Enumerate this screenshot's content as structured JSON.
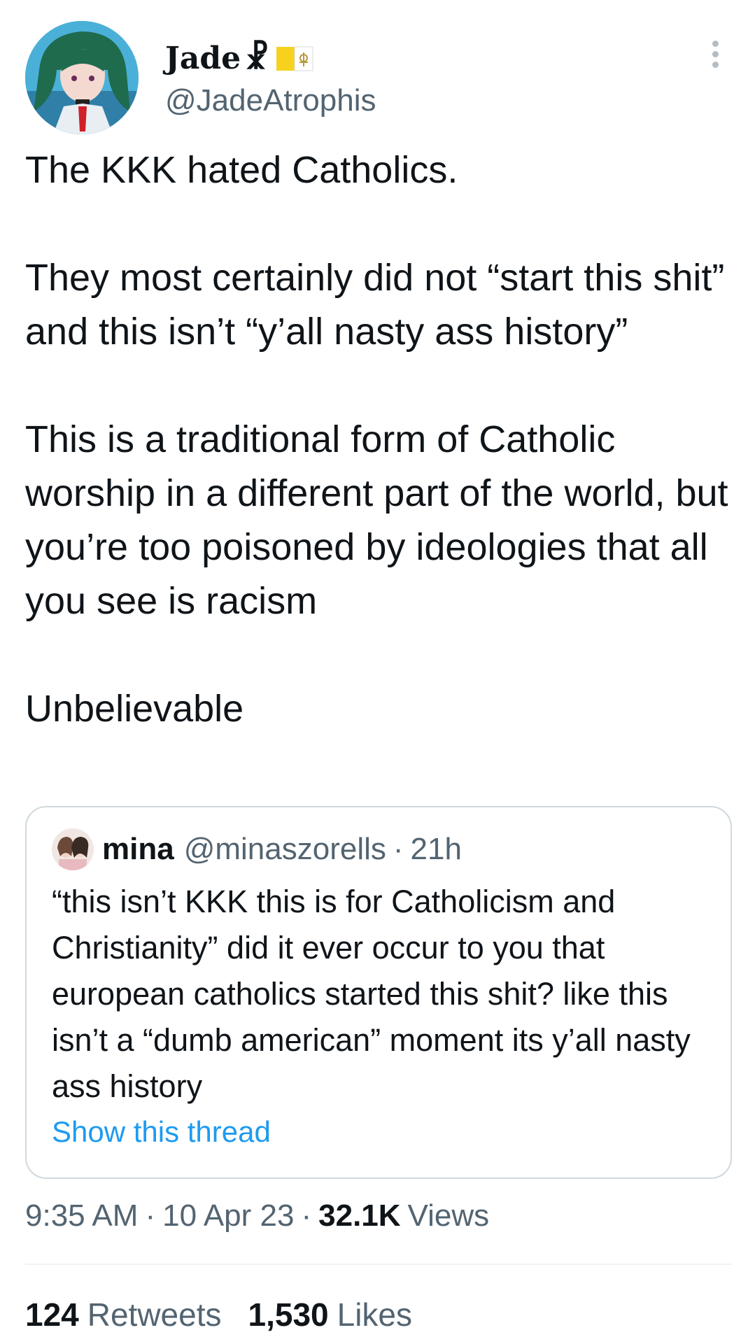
{
  "tweet": {
    "display_name": "Jade",
    "display_symbol": "☧",
    "handle": "@JadeAtrophis",
    "paragraphs": [
      "The KKK hated Catholics.",
      "They most certainly did not “start this shit” and this isn’t “y’all nasty ass history”",
      "This is a traditional form of Catholic worship in a different part of the world, but you’re too poisoned by ideologies that all you see is racism",
      "Unbelievable"
    ]
  },
  "quote": {
    "name": "mina",
    "handle": "@minaszorells",
    "separator": "·",
    "time": "21h",
    "text": "“this isn’t KKK this is for Catholicism and Christianity” did it ever occur to you that european catholics started this shit? like this isn’t a “dumb american” moment its y’all nasty ass history",
    "show_thread": "Show this thread"
  },
  "meta": {
    "time": "9:35 AM",
    "separator": "·",
    "date": "10 Apr 23",
    "views_count": "32.1K",
    "views_label": "Views"
  },
  "stats": {
    "retweets_count": "124",
    "retweets_label": "Retweets",
    "likes_count": "1,530",
    "likes_label": "Likes"
  },
  "colors": {
    "text_primary": "#0f1419",
    "text_secondary": "#536471",
    "link": "#1d9bf0",
    "border": "#cfd9de"
  },
  "icons": {
    "more": "more-vertical-icon",
    "flag": "vatican-flag-icon"
  }
}
